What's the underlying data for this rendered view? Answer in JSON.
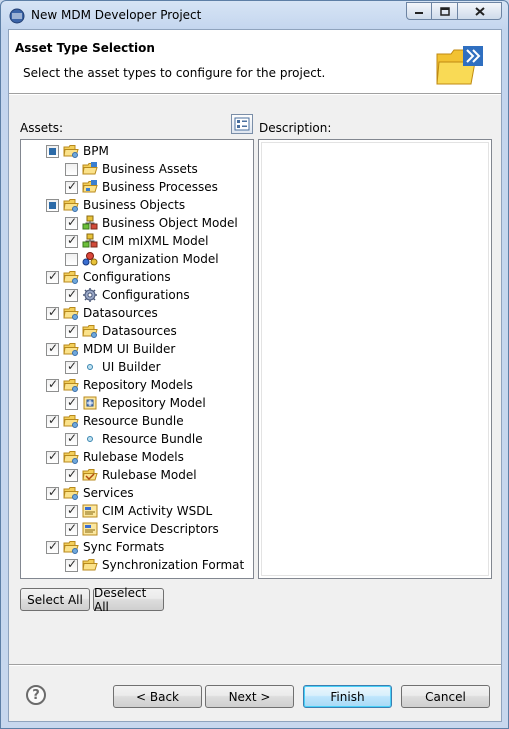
{
  "window": {
    "title": "New MDM Developer Project"
  },
  "header": {
    "title": "Asset Type Selection",
    "description": "Select the asset types to configure for the project."
  },
  "labels": {
    "assets": "Assets:",
    "description": "Description:"
  },
  "tree": [
    {
      "label": "BPM",
      "state": "partial",
      "level": 0,
      "icon": "folder-icon"
    },
    {
      "label": "Business Assets",
      "state": "unchecked",
      "level": 1,
      "icon": "business-assets-icon"
    },
    {
      "label": "Business Processes",
      "state": "checked",
      "level": 1,
      "icon": "business-process-icon"
    },
    {
      "label": "Business Objects",
      "state": "partial",
      "level": 0,
      "icon": "folder-icon"
    },
    {
      "label": "Business Object Model",
      "state": "checked",
      "level": 1,
      "icon": "object-model-icon"
    },
    {
      "label": "CIM mIXML Model",
      "state": "checked",
      "level": 1,
      "icon": "object-model-icon"
    },
    {
      "label": "Organization Model",
      "state": "unchecked",
      "level": 1,
      "icon": "organization-model-icon"
    },
    {
      "label": "Configurations",
      "state": "checked",
      "level": 0,
      "icon": "folder-icon"
    },
    {
      "label": "Configurations",
      "state": "checked",
      "level": 1,
      "icon": "gear-icon"
    },
    {
      "label": "Datasources",
      "state": "checked",
      "level": 0,
      "icon": "folder-icon"
    },
    {
      "label": "Datasources",
      "state": "checked",
      "level": 1,
      "icon": "datasource-icon"
    },
    {
      "label": "MDM UI Builder",
      "state": "checked",
      "level": 0,
      "icon": "folder-icon"
    },
    {
      "label": "UI Builder",
      "state": "checked",
      "level": 1,
      "icon": "dot-icon"
    },
    {
      "label": "Repository Models",
      "state": "checked",
      "level": 0,
      "icon": "folder-icon"
    },
    {
      "label": "Repository Model",
      "state": "checked",
      "level": 1,
      "icon": "repository-icon"
    },
    {
      "label": "Resource Bundle",
      "state": "checked",
      "level": 0,
      "icon": "folder-icon"
    },
    {
      "label": "Resource Bundle",
      "state": "checked",
      "level": 1,
      "icon": "dot-icon"
    },
    {
      "label": "Rulebase Models",
      "state": "checked",
      "level": 0,
      "icon": "folder-icon"
    },
    {
      "label": "Rulebase Model",
      "state": "checked",
      "level": 1,
      "icon": "rulebase-icon"
    },
    {
      "label": "Services",
      "state": "checked",
      "level": 0,
      "icon": "folder-icon"
    },
    {
      "label": "CIM Activity WSDL",
      "state": "checked",
      "level": 1,
      "icon": "service-icon"
    },
    {
      "label": "Service Descriptors",
      "state": "checked",
      "level": 1,
      "icon": "service-icon"
    },
    {
      "label": "Sync Formats",
      "state": "checked",
      "level": 0,
      "icon": "folder-icon"
    },
    {
      "label": "Synchronization Format",
      "state": "checked",
      "level": 1,
      "icon": "sync-format-icon"
    }
  ],
  "buttons": {
    "select_all": "Select All",
    "deselect_all": "Deselect All",
    "back": "< Back",
    "next": "Next >",
    "finish": "Finish",
    "cancel": "Cancel",
    "help": "?"
  }
}
